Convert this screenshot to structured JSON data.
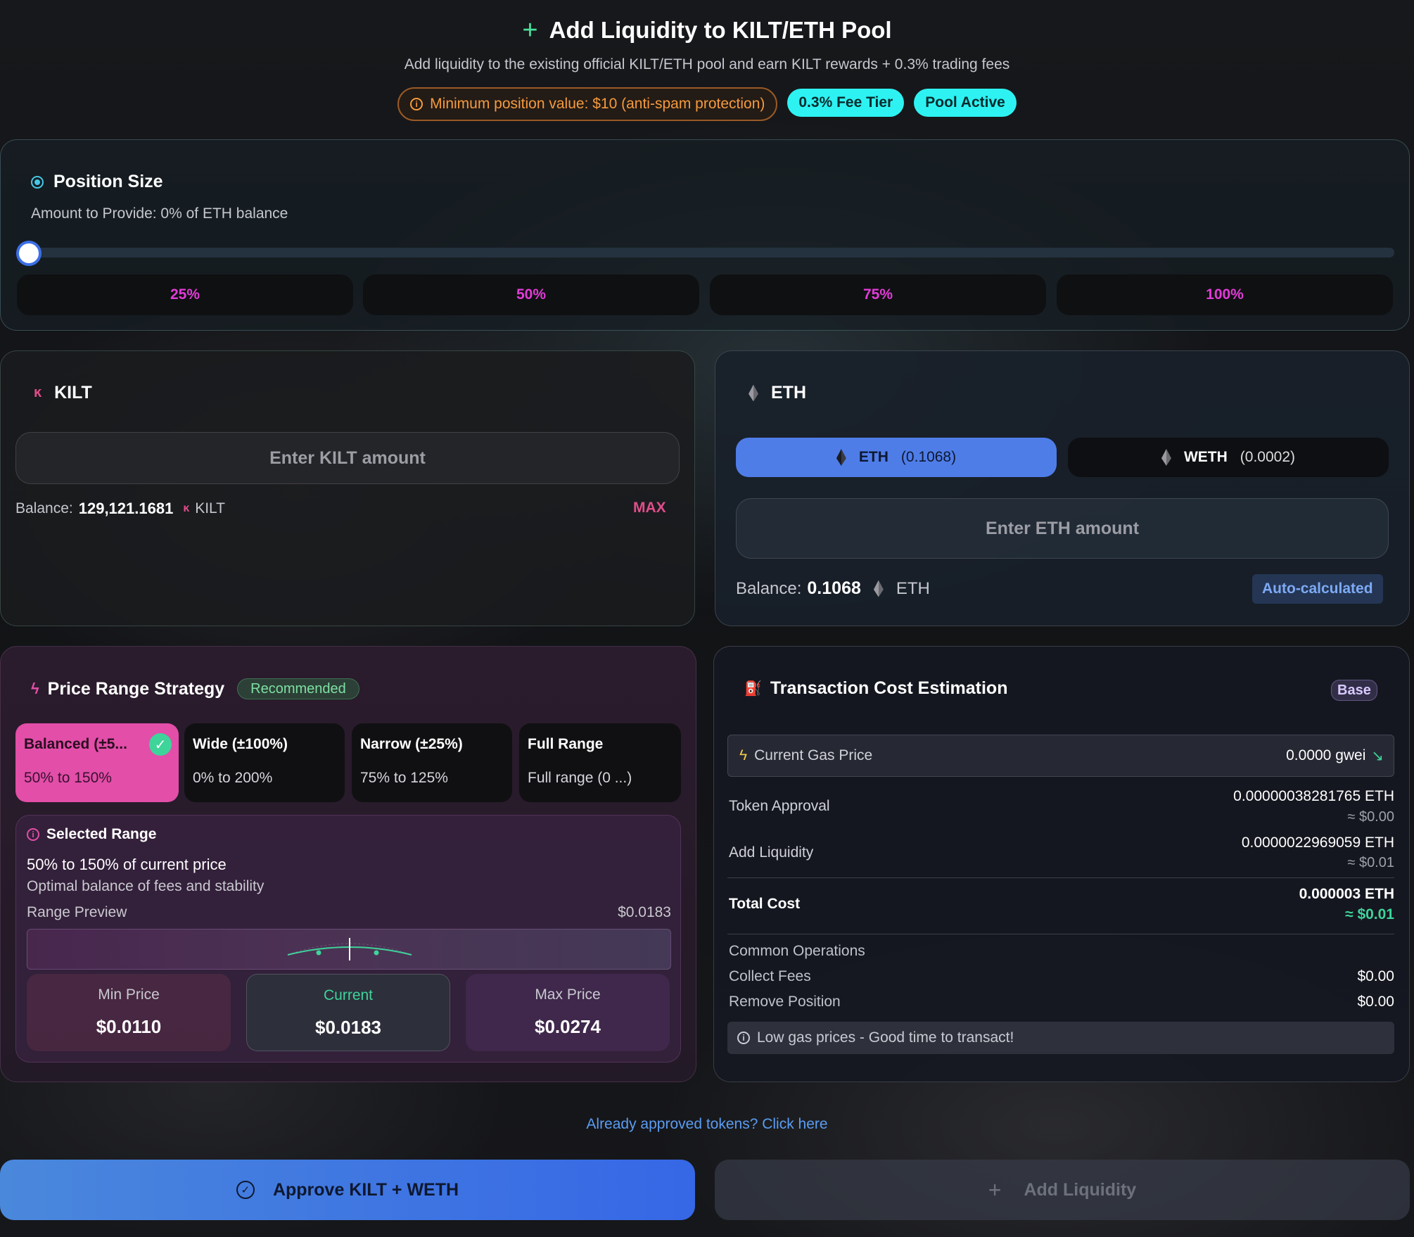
{
  "header": {
    "title": "Add Liquidity to KILT/ETH Pool",
    "subtitle": "Add liquidity to the existing official KILT/ETH pool and earn KILT rewards + 0.3% trading fees",
    "min_notice": "Minimum position value: $10 (anti-spam protection)",
    "fee_tier": "0.3% Fee Tier",
    "pool_status": "Pool Active"
  },
  "position": {
    "title": "Position Size",
    "subtitle": "Amount to Provide: 0% of ETH balance",
    "slider_fraction": 0,
    "presets": [
      "25%",
      "50%",
      "75%",
      "100%"
    ]
  },
  "kilt": {
    "label": "KILT",
    "placeholder": "Enter KILT amount",
    "balance_label": "Balance:",
    "balance": "129,121.1681",
    "unit": "KILT",
    "max_label": "MAX"
  },
  "eth": {
    "label": "ETH",
    "tabs": [
      {
        "label": "ETH",
        "count": "(0.1068)"
      },
      {
        "label": "WETH",
        "count": "(0.0002)"
      }
    ],
    "placeholder": "Enter ETH amount",
    "balance_label": "Balance:",
    "balance": "0.1068",
    "unit": "ETH",
    "auto_label": "Auto-calculated"
  },
  "strategy": {
    "title": "Price Range Strategy",
    "badge": "Recommended",
    "options": [
      {
        "name": "Balanced (±5...",
        "range": "50% to 150%",
        "selected": true
      },
      {
        "name": "Wide (±100%)",
        "range": "0% to 200%"
      },
      {
        "name": "Narrow (±25%)",
        "range": "75% to 125%"
      },
      {
        "name": "Full Range",
        "range": "Full range (0 ...)"
      }
    ],
    "selected_title": "Selected Range",
    "selected_line1": "50% to 150% of current price",
    "selected_line2": "Optimal balance of fees and stability",
    "preview_label": "Range Preview",
    "preview_price": "$0.0183",
    "min_label": "Min Price",
    "min_value": "$0.0110",
    "current_label": "Current",
    "current_value": "$0.0183",
    "max_label": "Max Price",
    "max_value": "$0.0274"
  },
  "tx": {
    "title": "Transaction Cost Estimation",
    "network": "Base",
    "gas_label": "Current Gas Price",
    "gas_value": "0.0000 gwei",
    "approval_label": "Token Approval",
    "approval_eth": "0.00000038281765 ETH",
    "approval_usd": "≈ $0.00",
    "add_label": "Add Liquidity",
    "add_eth": "0.0000022969059 ETH",
    "add_usd": "≈ $0.01",
    "total_label": "Total Cost",
    "total_eth": "0.000003 ETH",
    "total_usd": "≈ $0.01",
    "common_label": "Common Operations",
    "collect_label": "Collect Fees",
    "collect_value": "$0.00",
    "remove_label": "Remove Position",
    "remove_value": "$0.00",
    "low_gas_note": "Low gas prices - Good time to transact!"
  },
  "footer": {
    "approved_link": "Already approved tokens? Click here",
    "approve_button": "Approve KILT + WETH",
    "add_button": "Add Liquidity"
  },
  "colors": {
    "accent_pink": "#e24ea8",
    "accent_cyan": "#2ef2f2",
    "accent_blue": "#3b6fe6",
    "success_green": "#3ed49a",
    "warning_orange": "#f59a3e"
  }
}
